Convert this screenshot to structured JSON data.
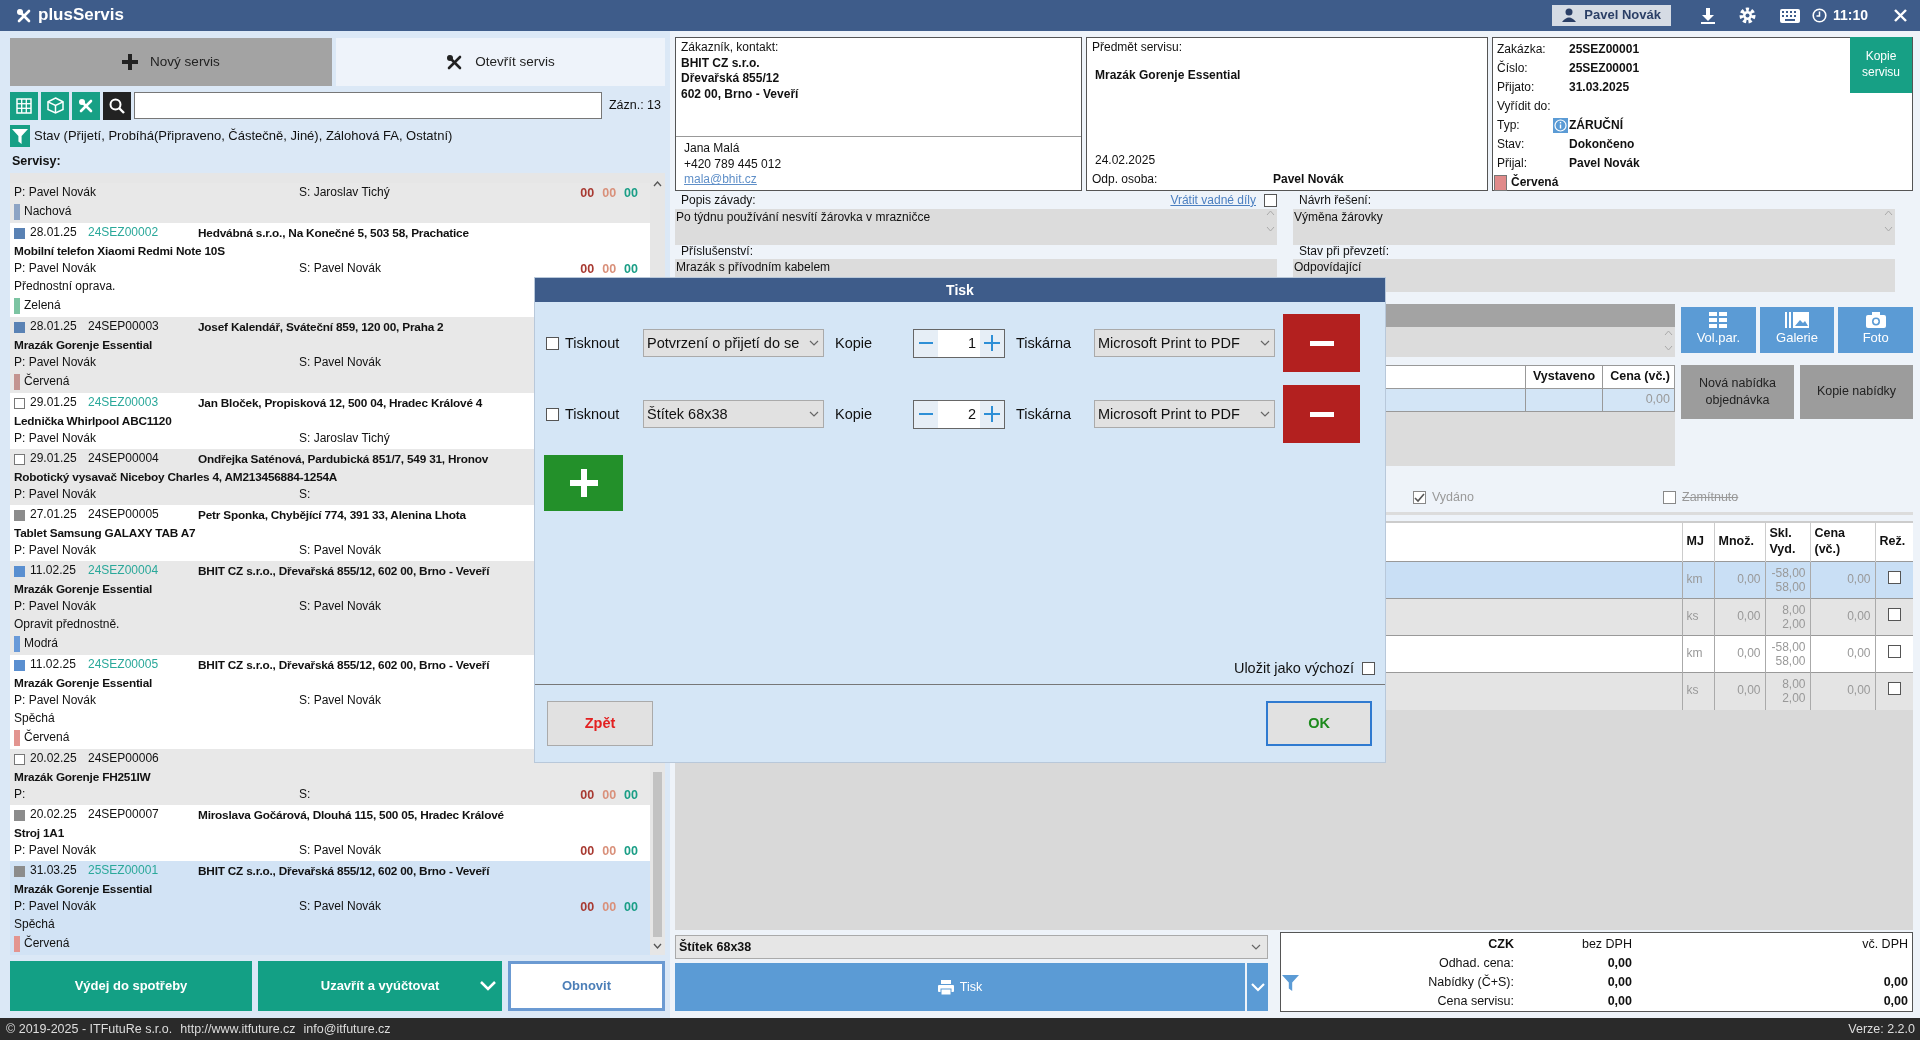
{
  "app": {
    "title": "plusServis"
  },
  "top_bar": {
    "user": "Pavel Novák",
    "time": "11:10"
  },
  "left": {
    "tabs": [
      {
        "label": "Nový servis",
        "selected": false,
        "kind": "new"
      },
      {
        "label": "Otevřít servis",
        "selected": true,
        "kind": "open"
      }
    ],
    "record_count": "Zázn.: 13",
    "filter": "Stav (Přijetí, Probíhá(Připraveno, Částečně, Jiné), Zálohová FA, Ostatní)",
    "list_title": "Servisy:",
    "items": [
      {
        "selected": false,
        "person": "P: Pavel Novák",
        "technician": "S: Jaroslav Tichý",
        "counters": [
          {
            "text": "00",
            "color": "#a83a32"
          },
          {
            "text": "00",
            "color": "#d9907a"
          },
          {
            "text": "00",
            "color": "#1a9e86"
          }
        ],
        "tag": {
          "label": "Nachová",
          "color": "#8ea4c4"
        }
      },
      {
        "selected": false,
        "marker": {
          "filled": true,
          "color": "#5a82b4"
        },
        "date": "28.01.25",
        "id": "24SEZ00002",
        "id_link": true,
        "address": "Hedvábná s.r.o., Na Konečné 5, 503 58, Prachatice",
        "title": "Mobilní telefon Xiaomi Redmi Note 10S",
        "person": "P: Pavel Novák",
        "technician": "S: Pavel Novák",
        "counters": [
          {
            "text": "00",
            "color": "#a83a32"
          },
          {
            "text": "00",
            "color": "#d9907a"
          },
          {
            "text": "00",
            "color": "#1a9e86"
          }
        ],
        "note": "Přednostní oprava.",
        "tag": {
          "label": "Zelená",
          "color": "#7cc4a2"
        }
      },
      {
        "selected": false,
        "marker": {
          "filled": true,
          "color": "#5a82b4"
        },
        "date": "28.01.25",
        "id": "24SEP00003",
        "id_link": false,
        "address": "Josef Kalendář, Sváteční 859, 120 00, Praha 2",
        "title": "Mrazák Gorenje Essential",
        "person": "P: Pavel Novák",
        "technician": "S: Pavel Novák",
        "tag": {
          "label": "Červená",
          "color": "#c4948f"
        }
      },
      {
        "selected": false,
        "marker": {
          "filled": false
        },
        "date": "29.01.25",
        "id": "24SEZ00003",
        "id_link": true,
        "address": "Jan Bloček, Propisková 12, 500 04, Hradec Králové 4",
        "title": "Lednička Whirlpool ABC1120",
        "person": "P: Pavel Novák",
        "technician": "S: Jaroslav Tichý"
      },
      {
        "selected": false,
        "marker": {
          "filled": false
        },
        "date": "29.01.25",
        "id": "24SEP00004",
        "id_link": false,
        "address": "Ondřejka Saténová, Pardubická 851/7, 549 31, Hronov",
        "title": "Robotický vysavač Niceboy Charles 4, AM213456884-1254A",
        "person": "P: Pavel Novák",
        "technician": "S:"
      },
      {
        "selected": false,
        "marker": {
          "filled": true,
          "color": "#8c8c8c"
        },
        "date": "27.01.25",
        "id": "24SEP00005",
        "id_link": false,
        "address": "Petr Sponka, Chybějící 774, 391 33, Alenina Lhota",
        "title": "Tablet Samsung GALAXY TAB A7",
        "person": "P: Pavel Novák",
        "technician": "S: Pavel Novák"
      },
      {
        "selected": false,
        "marker": {
          "filled": true,
          "color": "#5a8fd0"
        },
        "date": "11.02.25",
        "id": "24SEZ00004",
        "id_link": true,
        "address": "BHIT CZ s.r.o., Dřevařská 855/12, 602 00, Brno - Veveří",
        "title": "Mrazák Gorenje Essential",
        "person": "P: Pavel Novák",
        "technician": "S: Pavel Novák",
        "note": "Opravit přednostně.",
        "tag": {
          "label": "Modrá",
          "color": "#6a9ad8"
        }
      },
      {
        "selected": false,
        "marker": {
          "filled": true,
          "color": "#5a8fd0"
        },
        "date": "11.02.25",
        "id": "24SEZ00005",
        "id_link": true,
        "address": "BHIT CZ s.r.o., Dřevařská 855/12, 602 00, Brno - Veveří",
        "title": "Mrazák Gorenje Essential",
        "person": "P: Pavel Novák",
        "technician": "S: Pavel Novák",
        "note": "Spěchá",
        "tag": {
          "label": "Červená",
          "color": "#e39590"
        }
      },
      {
        "selected": false,
        "marker": {
          "filled": false
        },
        "date": "20.02.25",
        "id": "24SEP00006",
        "id_link": false,
        "title": "Mrazák Gorenje FH251IW",
        "person": "P:",
        "technician": "S:",
        "counters": [
          {
            "text": "00",
            "color": "#a83a32"
          },
          {
            "text": "00",
            "color": "#d9907a"
          },
          {
            "text": "00",
            "color": "#1a9e86"
          }
        ]
      },
      {
        "selected": false,
        "marker": {
          "filled": true,
          "color": "#8c8c8c"
        },
        "date": "20.02.25",
        "id": "24SEP00007",
        "id_link": false,
        "address": "Miroslava Gočárová, Dlouhá 115, 500 05, Hradec Králové",
        "title": "Stroj 1A1",
        "person": "P: Pavel Novák",
        "technician": "S: Pavel Novák",
        "counters": [
          {
            "text": "00",
            "color": "#a83a32"
          },
          {
            "text": "00",
            "color": "#d9907a"
          },
          {
            "text": "00",
            "color": "#1a9e86"
          }
        ]
      },
      {
        "selected": true,
        "marker": {
          "filled": true,
          "color": "#8c8c8c"
        },
        "date": "31.03.25",
        "id": "25SEZ00001",
        "id_link": true,
        "address": "BHIT CZ s.r.o., Dřevařská 855/12, 602 00, Brno - Veveří",
        "title": "Mrazák Gorenje Essential",
        "person": "P: Pavel Novák",
        "technician": "S: Pavel Novák",
        "counters": [
          {
            "text": "00",
            "color": "#a83a32"
          },
          {
            "text": "00",
            "color": "#d9907a"
          },
          {
            "text": "00",
            "color": "#1a9e86"
          }
        ],
        "note": "Spěchá",
        "tag": {
          "label": "Červená",
          "color": "#e39590"
        }
      }
    ],
    "buttons": [
      {
        "label": "Výdej do spotřeby",
        "kind": "solid"
      },
      {
        "label": "Uzavřít a vyúčtovat",
        "kind": "split"
      },
      {
        "label": "Obnovit",
        "kind": "outline"
      }
    ]
  },
  "customer": {
    "label": "Zákazník, kontakt:",
    "name": "BHIT CZ s.r.o.",
    "street": "Dřevařská 855/12",
    "city": "602 00, Brno - Veveří",
    "contact": "Jana Malá",
    "phone": "+420 789 445 012",
    "email": "mala@bhit.cz"
  },
  "subject": {
    "label": "Předmět servisu:",
    "device": "Mrazák Gorenje Essential",
    "date": "24.02.2025",
    "person_label": "Odp. osoba:",
    "person": "Pavel Novák"
  },
  "order": {
    "fields": [
      {
        "label": "Zakázka:",
        "value": "25SEZ00001"
      },
      {
        "label": "Číslo:",
        "value": "25SEZ00001"
      },
      {
        "label": "Přijato:",
        "value": "31.03.2025"
      },
      {
        "label": "Vyřídit do:"
      },
      {
        "label": "Typ:",
        "value": "ZÁRUČNÍ",
        "kind": "info"
      },
      {
        "label": "Stav:",
        "value": "Dokončeno"
      },
      {
        "label": "Přijal:",
        "value": "Pavel Novák"
      }
    ],
    "tag": {
      "label": "Červená",
      "color": "#e08a8a"
    },
    "copy_button": "Kopie servisu"
  },
  "fault": {
    "label": "Popis závady:",
    "value": "Po týdnu používání nesvítí žárovka v mrazničce",
    "return_label": "Vrátit vadné díly",
    "return_checked": false
  },
  "solution": {
    "label": "Návrh řešení:",
    "value": "Výměna žárovky"
  },
  "accessories": {
    "label": "Příslušenství:",
    "value": "Mrazák s přívodním kabelem"
  },
  "condition": {
    "label": "Stav při převzetí:",
    "value": "Odpovídající"
  },
  "media_buttons": [
    {
      "label": "Vol.par.",
      "kind": "grid"
    },
    {
      "label": "Galerie",
      "kind": "gallery"
    },
    {
      "label": "Foto",
      "kind": "camera"
    }
  ],
  "offers": {
    "columns": [
      "Vystaveno",
      "Cena (vč.)"
    ],
    "rows": [
      {
        "price": "0,00",
        "selected": true
      }
    ],
    "buttons": [
      "Nová nabídka objednávka",
      "Kopie nabídky"
    ]
  },
  "flags": [
    {
      "label": "Vydáno",
      "checked": true,
      "kind": "plain"
    },
    {
      "label": "Zamítnuto",
      "checked": false,
      "kind": "struck"
    }
  ],
  "items_table": {
    "columns": [
      "MJ",
      "Množ.",
      "Skl. Vyd.",
      "Cena (vč.)",
      "Rež."
    ],
    "rows": [
      {
        "unit": "km",
        "qty": "0,00",
        "stock": [
          "-58,00",
          "58,00"
        ],
        "price": "0,00",
        "checked": false,
        "selected": true
      },
      {
        "unit": "ks",
        "qty": "0,00",
        "stock": [
          "8,00",
          "2,00"
        ],
        "price": "0,00",
        "checked": false,
        "selected": false
      },
      {
        "unit": "km",
        "qty": "0,00",
        "stock": [
          "-58,00",
          "58,00"
        ],
        "price": "0,00",
        "checked": false,
        "selected": false
      },
      {
        "unit": "ks",
        "qty": "0,00",
        "stock": [
          "8,00",
          "2,00"
        ],
        "price": "0,00",
        "checked": false,
        "selected": false
      }
    ]
  },
  "print_bar": {
    "template": "Štítek 68x38",
    "button": "Tisk"
  },
  "totals": {
    "columns": [
      "CZK",
      "bez DPH",
      "vč. DPH"
    ],
    "rows": [
      {
        "label": "Odhad. cena:",
        "net": "0,00"
      },
      {
        "label": "Nabídky (Č+S):",
        "net": "0,00",
        "gross": "0,00"
      },
      {
        "label": "Cena servisu:",
        "net": "0,00",
        "gross": "0,00"
      }
    ]
  },
  "footer": {
    "copyright": "© 2019-2025 - ITFutuRe s.r.o.",
    "links": [
      "http://www.itfuture.cz",
      "info@itfuture.cz"
    ],
    "version": "Verze: 2.2.0"
  },
  "dialog": {
    "title": "Tisk",
    "rows": [
      {
        "print_label": "Tisknout",
        "checked": false,
        "template": "Potvrzení o přijetí do se",
        "copies_label": "Kopie",
        "copies": "1",
        "printer_label": "Tiskárna",
        "printer": "Microsoft Print to PDF"
      },
      {
        "print_label": "Tisknout",
        "checked": false,
        "template": "Štítek 68x38",
        "copies_label": "Kopie",
        "copies": "2",
        "printer_label": "Tiskárna",
        "printer": "Microsoft Print to PDF"
      }
    ],
    "save_default": {
      "label": "Uložit jako výchozí",
      "checked": false
    },
    "back": "Zpět",
    "ok": "OK"
  }
}
